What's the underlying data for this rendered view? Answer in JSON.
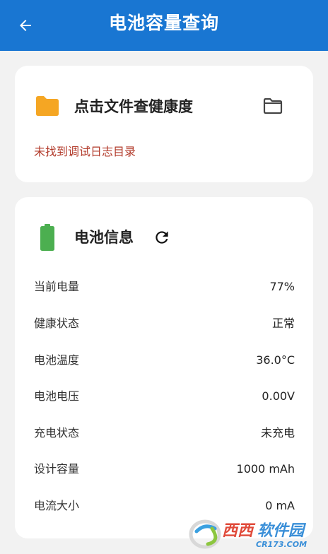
{
  "appbar": {
    "title": "电池容量查询",
    "back_icon": "arrow-left-icon",
    "color": "#1976d2"
  },
  "files_card": {
    "title": "点击文件查健康度",
    "status": "未找到调试日志目录",
    "folder_icon": "folder-filled-icon",
    "folder_icon_color": "#f5a623",
    "open_icon": "folder-outline-icon",
    "status_color": "#b23a2a"
  },
  "battery_card": {
    "title": "电池信息",
    "battery_icon": "battery-icon",
    "battery_icon_color": "#4caf50",
    "refresh_icon": "refresh-icon",
    "rows": [
      {
        "label": "当前电量",
        "value": "77%"
      },
      {
        "label": "健康状态",
        "value": "正常"
      },
      {
        "label": "电池温度",
        "value": "36.0°C"
      },
      {
        "label": "电池电压",
        "value": "0.00V"
      },
      {
        "label": "充电状态",
        "value": "未充电"
      },
      {
        "label": "设计容量",
        "value": "1000 mAh"
      },
      {
        "label": "电流大小",
        "value": "0 mA"
      }
    ]
  },
  "watermark": {
    "brand": "西西软件园",
    "domain": "CR173.COM"
  }
}
